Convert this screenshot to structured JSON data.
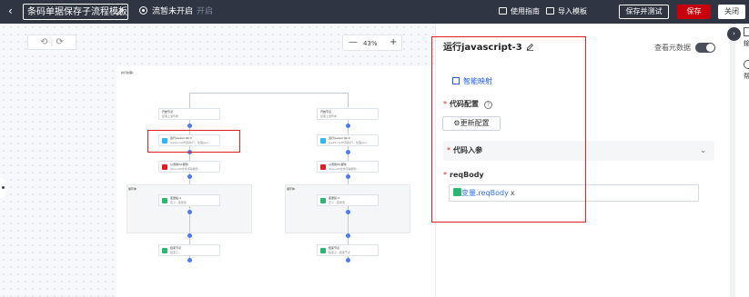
{
  "topbar": {
    "back_icon": "chevron-left-icon",
    "title": "条码单据保存子流程模板",
    "status_text": "流暂未开启",
    "status_toggle": "开启",
    "guide_label": "使用指南",
    "import_label": "导入模板",
    "save_test_label": "保存并测试",
    "save_label": "保存",
    "close_label": "关闭",
    "accent": "#c7000b"
  },
  "canvas": {
    "undo_symbol": "⟲",
    "redo_symbol": "⟳",
    "zoom_minus": "—",
    "zoom_value": "43%",
    "zoom_plus": "+",
    "flow_label": "并行处理1",
    "branches": [
      {
        "start_node": {
          "title": "开始节点",
          "desc": "接收上游传参"
        },
        "js_node": {
          "title": "运行javascript-3",
          "desc": "JavaScript代码执行，处理json..."
        },
        "api_node": {
          "title": "以调用ISC服务",
          "desc": "OpenAPI文件传输服务..."
        },
        "group_label": "循环体",
        "loop_node": {
          "title": "变量赋-1",
          "desc": "定义...变量值"
        },
        "end_node": {
          "title": "结束节点",
          "desc": "结束子..."
        }
      },
      {
        "start_node": {
          "title": "开始节点",
          "desc": "接收上游传参"
        },
        "js_node": {
          "title": "运行javascript-4",
          "desc": "JavaScript代码执行，处理json..."
        },
        "api_node": {
          "title": "以调用ISC服务",
          "desc": "OpenAPI文件传输服务..."
        },
        "group_label": "循环体",
        "loop_node": {
          "title": "变量赋-2",
          "desc": "定义...变量值"
        },
        "end_node": {
          "title": "结束节点",
          "desc": "结束子...结束节点"
        }
      }
    ]
  },
  "panel": {
    "title": "运行javascript-3",
    "meta_label": "查看元数据",
    "meta_toggle_on": true,
    "smart_map": "智能映射",
    "code_config_label": "代码配置",
    "help_symbol": "?",
    "update_config_button": "⚙更新配置",
    "code_input_section": "代码入参",
    "param_label": "reqBody",
    "param_value_tag": "变量.reqBody",
    "tag_remove": "x",
    "required_mark": "*"
  },
  "side": {
    "fab_icon": "chevron-left-icon",
    "items": [
      "输",
      "帮"
    ]
  }
}
